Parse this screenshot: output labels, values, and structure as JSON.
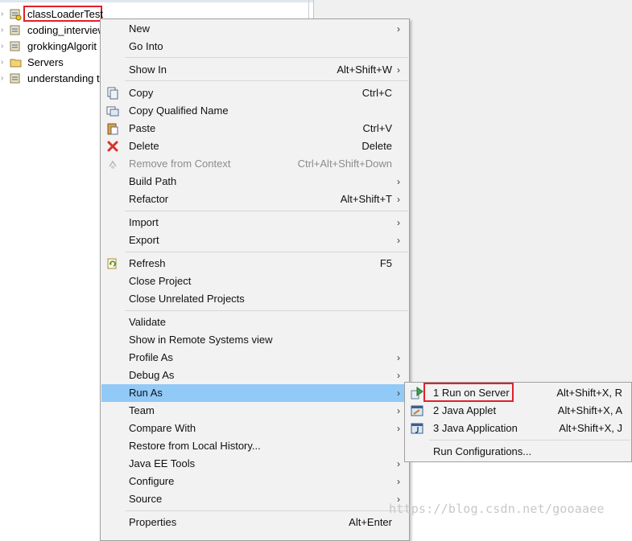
{
  "explorer": {
    "items": [
      {
        "label": "classLoaderTest",
        "selected": true,
        "icon": "java-project-icon"
      },
      {
        "label": "coding_interview",
        "icon": "java-project-icon"
      },
      {
        "label": "grokkingAlgorit",
        "icon": "java-project-icon"
      },
      {
        "label": "Servers",
        "icon": "folder-icon"
      },
      {
        "label": "understanding t",
        "icon": "java-project-icon"
      }
    ]
  },
  "menu": {
    "items": [
      {
        "label": "New",
        "shortcut": "",
        "submenu": true
      },
      {
        "label": "Go Into",
        "shortcut": ""
      },
      {
        "label": "Show In",
        "shortcut": "Alt+Shift+W",
        "submenu": true
      },
      {
        "label": "Copy",
        "shortcut": "Ctrl+C",
        "icon": "copy-icon"
      },
      {
        "label": "Copy Qualified Name",
        "shortcut": "",
        "icon": "copy-qualified-icon"
      },
      {
        "label": "Paste",
        "shortcut": "Ctrl+V",
        "icon": "paste-icon"
      },
      {
        "label": "Delete",
        "shortcut": "Delete",
        "icon": "delete-icon"
      },
      {
        "label": "Remove from Context",
        "shortcut": "Ctrl+Alt+Shift+Down",
        "disabled": true,
        "icon": "remove-context-icon"
      },
      {
        "label": "Build Path",
        "shortcut": "",
        "submenu": true
      },
      {
        "label": "Refactor",
        "shortcut": "Alt+Shift+T",
        "submenu": true
      },
      {
        "label": "Import",
        "shortcut": "",
        "submenu": true
      },
      {
        "label": "Export",
        "shortcut": "",
        "submenu": true
      },
      {
        "label": "Refresh",
        "shortcut": "F5",
        "icon": "refresh-icon"
      },
      {
        "label": "Close Project",
        "shortcut": ""
      },
      {
        "label": "Close Unrelated Projects",
        "shortcut": ""
      },
      {
        "label": "Validate",
        "shortcut": ""
      },
      {
        "label": "Show in Remote Systems view",
        "shortcut": ""
      },
      {
        "label": "Profile As",
        "shortcut": "",
        "submenu": true
      },
      {
        "label": "Debug As",
        "shortcut": "",
        "submenu": true
      },
      {
        "label": "Run As",
        "shortcut": "",
        "submenu": true,
        "highlighted": true
      },
      {
        "label": "Team",
        "shortcut": "",
        "submenu": true
      },
      {
        "label": "Compare With",
        "shortcut": "",
        "submenu": true
      },
      {
        "label": "Restore from Local History...",
        "shortcut": ""
      },
      {
        "label": "Java EE Tools",
        "shortcut": "",
        "submenu": true
      },
      {
        "label": "Configure",
        "shortcut": "",
        "submenu": true
      },
      {
        "label": "Source",
        "shortcut": "",
        "submenu": true
      },
      {
        "label": "Properties",
        "shortcut": "Alt+Enter"
      }
    ]
  },
  "submenu": {
    "items": [
      {
        "label": "1 Run on Server",
        "shortcut": "Alt+Shift+X, R",
        "icon": "run-server-icon",
        "boxed": true
      },
      {
        "label": "2 Java Applet",
        "shortcut": "Alt+Shift+X, A",
        "icon": "java-applet-icon"
      },
      {
        "label": "3 Java Application",
        "shortcut": "Alt+Shift+X, J",
        "icon": "java-app-icon"
      },
      {
        "label": "Run Configurations...",
        "shortcut": ""
      }
    ]
  },
  "submenu_arrow": "›",
  "watermark": "https://blog.csdn.net/gooaaee",
  "colors": {
    "highlight": "#91c9f7",
    "red_box": "#e0202b",
    "menu_bg": "#f2f2f2"
  }
}
